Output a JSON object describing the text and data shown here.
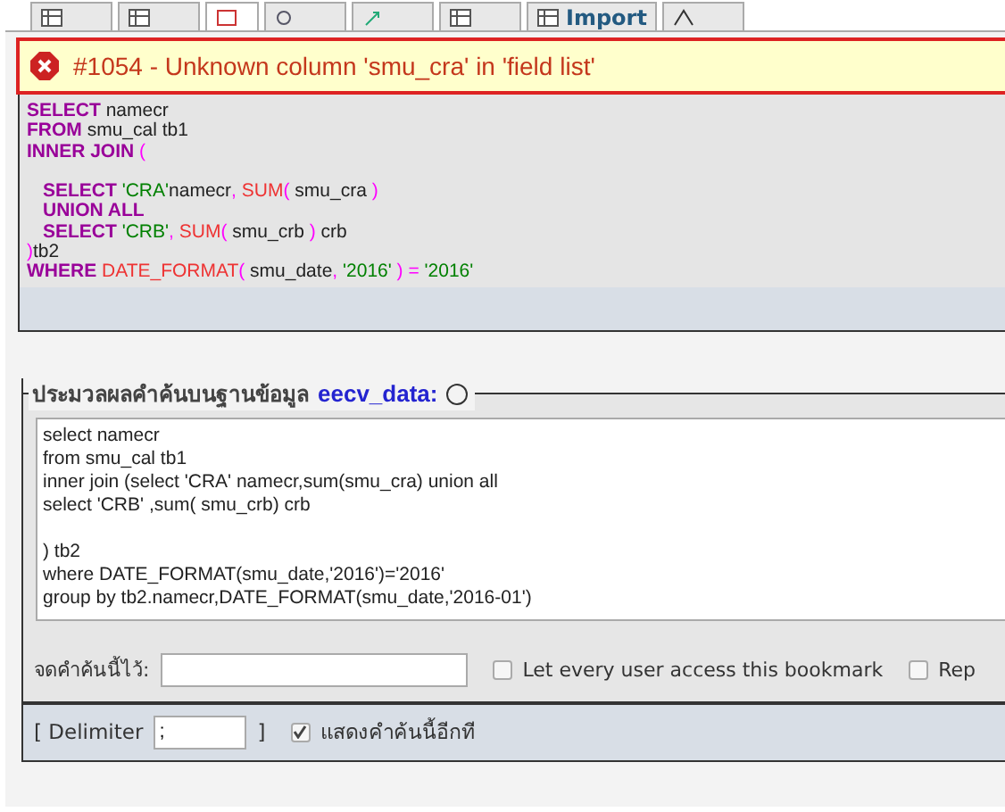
{
  "tabs": [
    {
      "selected": false
    },
    {
      "selected": false
    },
    {
      "selected": true
    },
    {
      "selected": false
    },
    {
      "selected": false
    },
    {
      "selected": false
    },
    {
      "label": "Import",
      "selected": false
    },
    {
      "selected": false
    }
  ],
  "error": {
    "message": "#1054 - Unknown column 'smu_cra' in 'field list'"
  },
  "query_lines": [
    {
      "kind": "top",
      "tokens": [
        {
          "kind": "keyword",
          "text": "SELECT"
        },
        {
          "kind": "plain",
          "text": " namecr"
        }
      ]
    },
    {
      "kind": "top",
      "tokens": [
        {
          "kind": "keyword",
          "text": "FROM"
        },
        {
          "kind": "plain",
          "text": " smu_cal tb1"
        }
      ]
    },
    {
      "kind": "top",
      "tokens": [
        {
          "kind": "keyword",
          "text": "INNER JOIN"
        },
        {
          "kind": "punct",
          "text": " ("
        }
      ]
    },
    {
      "kind": "nested_after_blank",
      "tokens": [
        {
          "kind": "keyword",
          "text": "SELECT"
        },
        {
          "kind": "string",
          "text": " 'CRA'"
        },
        {
          "kind": "plain",
          "text": "namecr"
        },
        {
          "kind": "punct",
          "text": ", "
        },
        {
          "kind": "function",
          "text": "SUM"
        },
        {
          "kind": "punct",
          "text": "( "
        },
        {
          "kind": "plain",
          "text": "smu_cra "
        },
        {
          "kind": "punct",
          "text": ")"
        }
      ]
    },
    {
      "kind": "nested",
      "tokens": [
        {
          "kind": "keyword",
          "text": "UNION ALL"
        }
      ]
    },
    {
      "kind": "nested",
      "tokens": [
        {
          "kind": "keyword",
          "text": "SELECT"
        },
        {
          "kind": "string",
          "text": " 'CRB'"
        },
        {
          "kind": "punct",
          "text": ", "
        },
        {
          "kind": "function",
          "text": "SUM"
        },
        {
          "kind": "punct",
          "text": "( "
        },
        {
          "kind": "plain",
          "text": "smu_crb "
        },
        {
          "kind": "punct",
          "text": ") "
        },
        {
          "kind": "plain",
          "text": "crb"
        }
      ]
    },
    {
      "kind": "top",
      "tokens": [
        {
          "kind": "punct",
          "text": ")"
        },
        {
          "kind": "plain",
          "text": "tb2"
        }
      ]
    },
    {
      "kind": "top",
      "tokens": [
        {
          "kind": "keyword",
          "text": "WHERE"
        },
        {
          "kind": "function",
          "text": " DATE_FORMAT"
        },
        {
          "kind": "punct",
          "text": "( "
        },
        {
          "kind": "plain",
          "text": "smu_date"
        },
        {
          "kind": "punct",
          "text": ", "
        },
        {
          "kind": "string",
          "text": "'2016'"
        },
        {
          "kind": "punct",
          "text": " ) = "
        },
        {
          "kind": "string",
          "text": "'2016'"
        }
      ]
    }
  ],
  "query_box": {
    "legend": "ประมวลผลคำค้นบนฐานข้อมูล",
    "database": "eecv_data:",
    "value": "select namecr\nfrom smu_cal tb1\ninner join (select 'CRA' namecr,sum(smu_cra) union all\nselect 'CRB' ,sum( smu_crb) crb\n\n) tb2\nwhere DATE_FORMAT(smu_date,'2016')='2016'\ngroup by tb2.namecr,DATE_FORMAT(smu_date,'2016-01')"
  },
  "bookmark": {
    "label": "จดคำค้นนี้ไว้:",
    "options": [
      {
        "label": "Let every user access this bookmark",
        "checked": false
      },
      {
        "label": "Rep",
        "checked": false
      }
    ]
  },
  "footer": {
    "delimiter_label": "[ Delimiter",
    "delimiter_value": ";",
    "close_bracket": "]",
    "show_again": {
      "label": "แสดงคำค้นนี้อีกที",
      "checked": true
    }
  }
}
